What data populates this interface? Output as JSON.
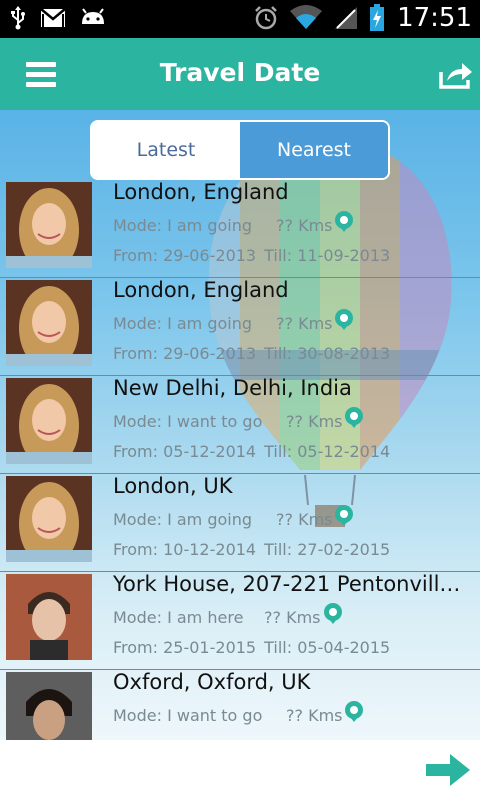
{
  "status_bar": {
    "time": "17:51",
    "icons": [
      "usb-icon",
      "gmail-icon",
      "android-icon",
      "alarm-icon",
      "wifi-icon",
      "signal-icon",
      "battery-charging-icon"
    ]
  },
  "header": {
    "title": "Travel Date",
    "menu_icon": "hamburger-menu-icon",
    "share_icon": "share-icon"
  },
  "tabs": [
    {
      "label": "Latest",
      "selected": false
    },
    {
      "label": "Nearest",
      "selected": true
    }
  ],
  "trips": [
    {
      "place": "London, England",
      "mode": "Mode: I am going",
      "distance": "?? Kms",
      "from": "From: 29-06-2013",
      "till": "Till: 11-09-2013",
      "avatar": "girl-avatar"
    },
    {
      "place": "London, England",
      "mode": "Mode: I am going",
      "distance": "?? Kms",
      "from": "From: 29-06-2013",
      "till": "Till: 30-08-2013",
      "avatar": "girl-avatar"
    },
    {
      "place": "New Delhi, Delhi, India",
      "mode": "Mode: I want to go",
      "distance": "?? Kms",
      "from": "From: 05-12-2014",
      "till": "Till: 05-12-2014",
      "avatar": "girl-avatar"
    },
    {
      "place": "London, UK",
      "mode": "Mode: I am going",
      "distance": "?? Kms",
      "from": "From: 10-12-2014",
      "till": "Till: 27-02-2015",
      "avatar": "girl-avatar"
    },
    {
      "place": "York House, 207-221 Pentonvill…",
      "mode": "Mode: I am here",
      "distance": "?? Kms",
      "from": "From: 25-01-2015",
      "till": "Till: 05-04-2015",
      "avatar": "man-avatar"
    },
    {
      "place": "Oxford, Oxford, UK",
      "mode": "Mode: I want to go",
      "distance": "?? Kms",
      "from": "",
      "till": "",
      "avatar": "man-dark-avatar"
    }
  ],
  "colors": {
    "accent": "#2bb5a0",
    "tab_selected": "#4b9bd8",
    "pin": "#2bb5a0"
  },
  "footer": {
    "next_icon": "arrow-right-icon"
  }
}
